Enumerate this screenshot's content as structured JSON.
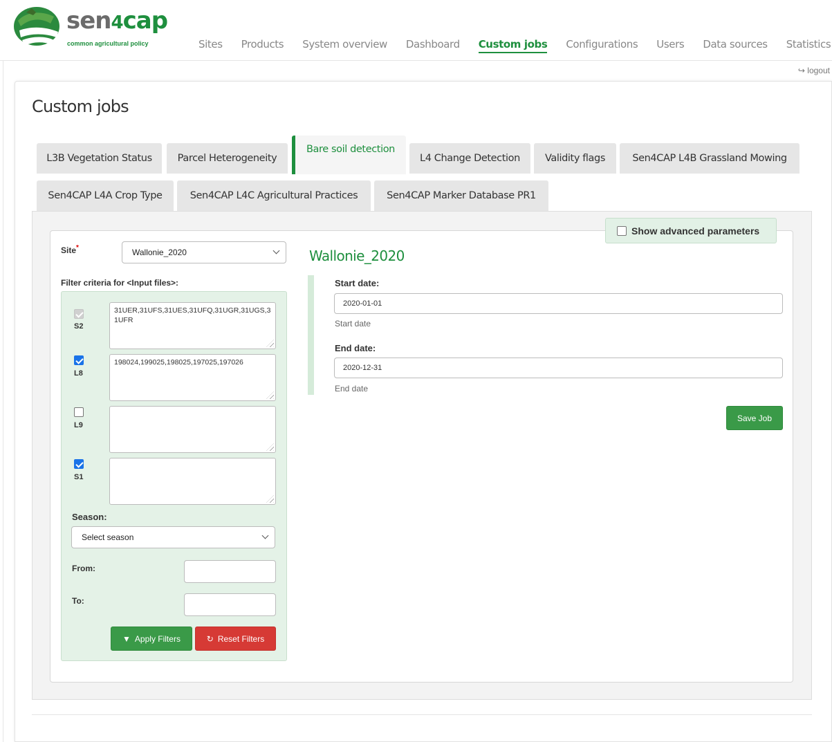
{
  "brand": {
    "name_prefix": "sen",
    "name_four": "4",
    "name_suffix": "cap",
    "tagline": "common agricultural policy"
  },
  "nav": {
    "items": [
      {
        "label": "Sites"
      },
      {
        "label": "Products"
      },
      {
        "label": "System overview"
      },
      {
        "label": "Dashboard"
      },
      {
        "label": "Custom jobs"
      },
      {
        "label": "Configurations"
      },
      {
        "label": "Users"
      },
      {
        "label": "Data sources"
      },
      {
        "label": "Statistics"
      }
    ],
    "active": "Custom jobs"
  },
  "logout_label": "logout",
  "page_title": "Custom jobs",
  "tabs": [
    {
      "label": "L3B Vegetation Status"
    },
    {
      "label": "Parcel Heterogeneity"
    },
    {
      "label": "Bare soil detection"
    },
    {
      "label": "L4 Change Detection"
    },
    {
      "label": "Validity flags"
    },
    {
      "label": "Sen4CAP L4B Grassland Mowing"
    },
    {
      "label": "Sen4CAP L4A Crop Type"
    },
    {
      "label": "Sen4CAP L4C Agricultural Practices"
    },
    {
      "label": "Sen4CAP Marker Database PR1"
    }
  ],
  "active_tab": "Bare soil detection",
  "advanced": {
    "label": "Show advanced parameters",
    "checked": false
  },
  "form": {
    "site_label": "Site",
    "site_required_mark": "*",
    "site_value": "Wallonie_2020",
    "filter_title": "Filter criteria for <Input files>:",
    "sensors": [
      {
        "label": "S2",
        "checked": true,
        "disabled": true,
        "tiles": "31UER,31UFS,31UES,31UFQ,31UGR,31UGS,31UFR"
      },
      {
        "label": "L8",
        "checked": true,
        "disabled": false,
        "tiles": "198024,199025,198025,197025,197026"
      },
      {
        "label": "L9",
        "checked": false,
        "disabled": false,
        "tiles": ""
      },
      {
        "label": "S1",
        "checked": true,
        "disabled": false,
        "tiles": ""
      }
    ],
    "season_label": "Season:",
    "season_placeholder": "Select season",
    "from_label": "From:",
    "to_label": "To:",
    "apply_label": "Apply Filters",
    "reset_label": "Reset Filters"
  },
  "params": {
    "site_title": "Wallonie_2020",
    "start_label": "Start date:",
    "start_value": "2020-01-01",
    "start_help": "Start date",
    "end_label": "End date:",
    "end_value": "2020-12-31",
    "end_help": "End date",
    "save_label": "Save Job"
  },
  "colors": {
    "brand_green": "#1e8f3e",
    "button_green": "#3a9a48",
    "button_red": "#d63a35",
    "filter_bg": "#e4f2e7"
  }
}
